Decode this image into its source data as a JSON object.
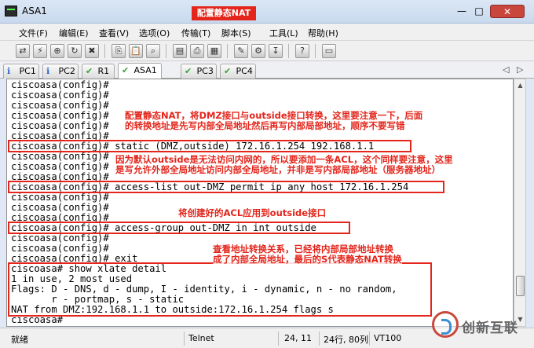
{
  "window": {
    "title": "ASA1",
    "title_annotation": "配置静态NAT",
    "controls": {
      "minimize": "—",
      "maximize": "□",
      "close": "✕"
    }
  },
  "menu": [
    {
      "label": "文件(F)"
    },
    {
      "label": "编辑(E)"
    },
    {
      "label": "查看(V)"
    },
    {
      "label": "选项(O)"
    },
    {
      "label": "传输(T)"
    },
    {
      "label": "脚本(S)"
    },
    {
      "label": "工具(L)"
    },
    {
      "label": "帮助(H)"
    }
  ],
  "toolbar": [
    {
      "icon": "connect-icon",
      "glyph": "⇄"
    },
    {
      "icon": "quick-connect-icon",
      "glyph": "⚡"
    },
    {
      "icon": "connect-tab-icon",
      "glyph": "⊕"
    },
    {
      "icon": "reconnect-icon",
      "glyph": "↻"
    },
    {
      "icon": "disconnect-icon",
      "glyph": "✖"
    },
    {
      "icon": "copy-icon",
      "glyph": "⎘"
    },
    {
      "icon": "paste-icon",
      "glyph": "📋"
    },
    {
      "icon": "find-icon",
      "glyph": "⌕"
    },
    {
      "icon": "print-setup-icon",
      "glyph": "▤"
    },
    {
      "icon": "print-icon",
      "glyph": "⎙"
    },
    {
      "icon": "print-screen-icon",
      "glyph": "▦"
    },
    {
      "icon": "session-options-icon",
      "glyph": "✎"
    },
    {
      "icon": "global-options-icon",
      "glyph": "⚙"
    },
    {
      "icon": "keymap-icon",
      "glyph": "↧"
    },
    {
      "icon": "help-icon",
      "glyph": "?"
    },
    {
      "icon": "screen-icon",
      "glyph": "▭"
    }
  ],
  "tabs": [
    {
      "label": "PC1",
      "status": "info",
      "mark": "ℹ",
      "active": false
    },
    {
      "label": "PC2",
      "status": "info",
      "mark": "ℹ",
      "active": false
    },
    {
      "label": "R1",
      "status": "connected",
      "mark": "✔",
      "active": false
    },
    {
      "label": "ASA1",
      "status": "connected",
      "mark": "✔",
      "active": true
    },
    {
      "label": "PC3",
      "status": "connected",
      "mark": "✔",
      "active": false
    },
    {
      "label": "PC4",
      "status": "connected",
      "mark": "✔",
      "active": false
    }
  ],
  "tab_nav": {
    "prev": "◁",
    "next": "▷"
  },
  "terminal": {
    "lines": [
      "ciscoasa(config)#",
      "ciscoasa(config)#",
      "ciscoasa(config)#",
      "ciscoasa(config)#",
      "ciscoasa(config)#",
      "ciscoasa(config)#",
      "ciscoasa(config)# static (DMZ,outside) 172.16.1.254 192.168.1.1",
      "ciscoasa(config)#",
      "ciscoasa(config)#",
      "ciscoasa(config)#",
      "ciscoasa(config)# access-list out-DMZ permit ip any host 172.16.1.254",
      "ciscoasa(config)#",
      "ciscoasa(config)#",
      "ciscoasa(config)#",
      "ciscoasa(config)# access-group out-DMZ in int outside",
      "ciscoasa(config)#",
      "ciscoasa(config)#",
      "ciscoasa(config)# exit",
      "ciscoasa# show xlate detail",
      "1 in use, 2 most used",
      "Flags: D - DNS, d - dump, I - identity, i - dynamic, n - no random,",
      "       r - portmap, s - static",
      "NAT from DMZ:192.168.1.1 to outside:172.16.1.254 flags s",
      "ciscoasa#"
    ]
  },
  "annotations": [
    "配置静态NAT，将DMZ接口与outside接口转换，这里要注意一下，后面\n的转换地址是先写内部全局地址然后再写内部局部地址，顺序不要写错",
    "因为默认outside是无法访问内网的，所以要添加一条ACL，这个同样要注意，这里\n是写允许外部全局地址访问内部全局地址，并非是写内部局部地址（服务器地址）",
    "将创建好的ACL应用到outside接口",
    "查看地址转换关系，已经将内部局部地址转换\n成了内部全局地址，最后的S代表静态NAT转换"
  ],
  "annotation_color": "#e3251b",
  "statusbar": {
    "status": "就绪",
    "protocol": "Telnet",
    "cursor": "24, 11",
    "size": "24行, 80列",
    "terminal_type": "VT100"
  },
  "watermark": {
    "text": "创新互联"
  }
}
